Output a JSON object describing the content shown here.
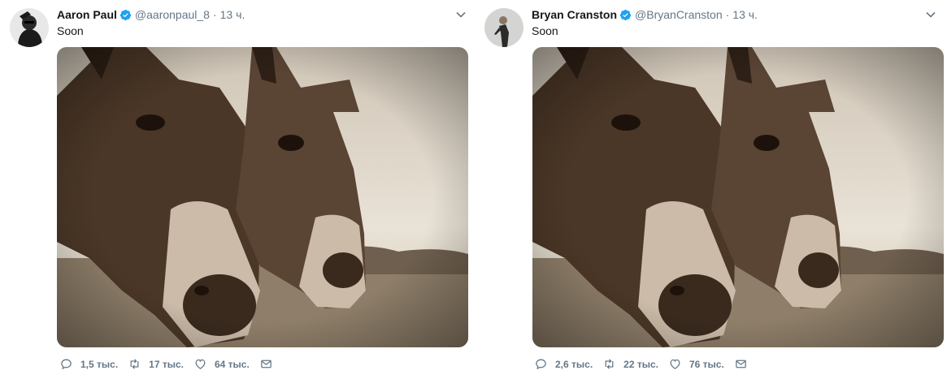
{
  "tweets": [
    {
      "name": "Aaron Paul",
      "handle": "@aaronpaul_8",
      "time": "13 ч.",
      "dot": "·",
      "text": "Soon",
      "stats": {
        "replies": "1,5 тыс.",
        "retweets": "17 тыс.",
        "likes": "64 тыс."
      }
    },
    {
      "name": "Bryan Cranston",
      "handle": "@BryanCranston",
      "time": "13 ч.",
      "dot": "·",
      "text": "Soon",
      "stats": {
        "replies": "2,6 тыс.",
        "retweets": "22 тыс.",
        "likes": "76 тыс."
      }
    }
  ],
  "colors": {
    "verified": "#1da1f2",
    "muted": "#657786",
    "sepia_dark": "#3b2a1e",
    "sepia_light": "#d9cdbb"
  },
  "icons": [
    "verified-badge-icon",
    "chevron-down-icon",
    "reply-icon",
    "retweet-icon",
    "like-icon",
    "dm-icon"
  ]
}
